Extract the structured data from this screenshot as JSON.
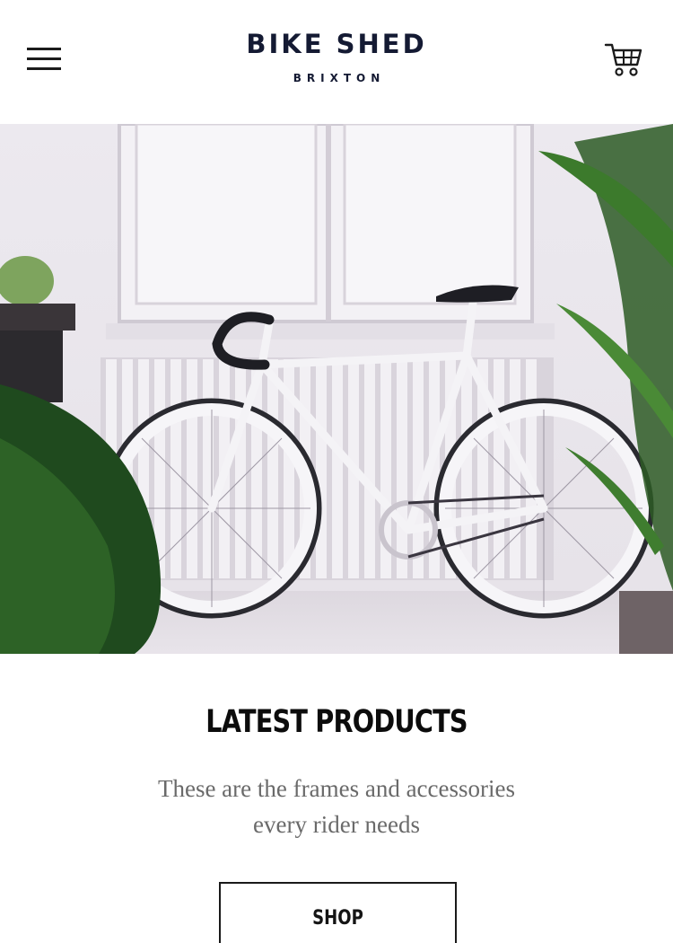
{
  "header": {
    "brand_title": "BIKE SHED",
    "brand_subtitle": "BRIXTON",
    "menu_icon": "hamburger-menu-icon",
    "cart_icon": "shopping-cart-icon",
    "text_color": "#141a33"
  },
  "hero": {
    "image": "hero-bicycle-photo",
    "subject": "white fixed-gear bicycle leaning against radiator with plants"
  },
  "section": {
    "title": "LATEST PRODUCTS",
    "description_line1": "These are the frames and accessories",
    "description_line2": "every rider needs",
    "button_label": "SHOP"
  }
}
